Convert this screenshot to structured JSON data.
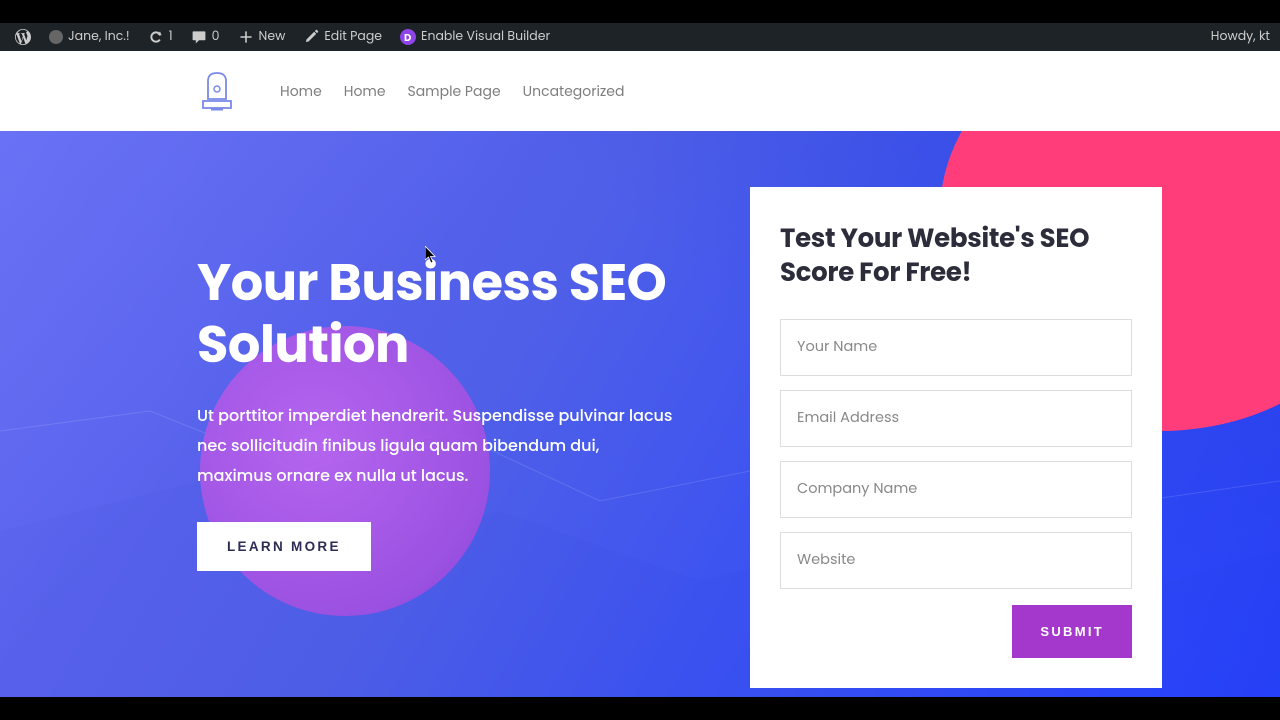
{
  "admin": {
    "site_name": "Jane, Inc.!",
    "refresh_count": "1",
    "comments_count": "0",
    "new_label": "New",
    "edit_page_label": "Edit Page",
    "visual_builder_label": "Enable Visual Builder",
    "howdy": "Howdy, kt"
  },
  "nav": {
    "items": [
      "Home",
      "Home",
      "Sample Page",
      "Uncategorized"
    ]
  },
  "hero": {
    "title": "Your Business SEO Solution",
    "description": "Ut porttitor imperdiet hendrerit. Suspendisse pulvinar lacus nec sollicitudin finibus ligula quam bibendum dui, maximus ornare ex nulla ut lacus.",
    "cta": "LEARN MORE"
  },
  "form": {
    "title": "Test Your Website's SEO Score For Free!",
    "placeholders": {
      "name": "Your Name",
      "email": "Email Address",
      "company": "Company Name",
      "website": "Website"
    },
    "submit": "SUBMIT"
  }
}
